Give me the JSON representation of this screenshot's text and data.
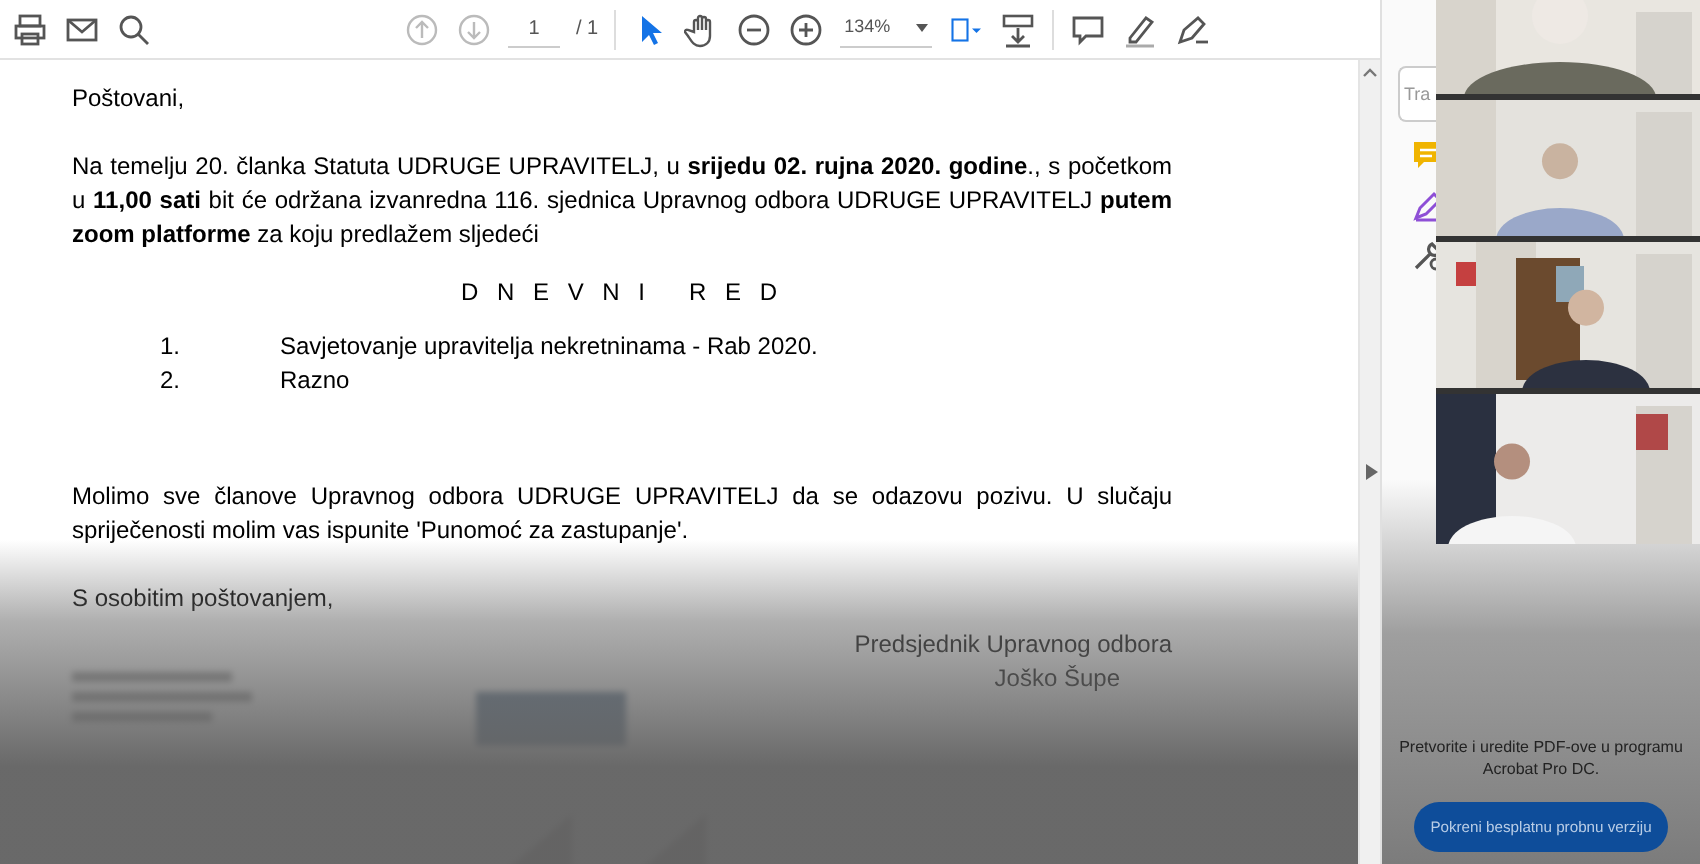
{
  "toolbar": {
    "page_number": "1",
    "page_total": "/ 1",
    "zoom": "134%",
    "tools": [
      {
        "kind": "select",
        "selected": true
      },
      {
        "kind": "hand",
        "selected": false
      }
    ]
  },
  "document": {
    "salutation": "Poštovani,",
    "intro": "Na temelju 20. članka Statuta UDRUGE UPRAVITELJ, u **srijedu 02. rujna 2020. godine**., s početkom u **11,00 sati** bit će održana izvanredna 116. sjednica Upravnog odbora UDRUGE UPRAVITELJ **putem zoom platforme** za koju predlažem sljedeći",
    "agenda_title": "D N E V N I   R E D",
    "agenda": [
      {
        "number": "1.",
        "text": "Savjetovanje upravitelja nekretninama - Rab 2020."
      },
      {
        "number": "2.",
        "text": "Razno"
      }
    ],
    "request": "Molimo sve članove Upravnog odbora UDRUGE UPRAVITELJ da se odazovu pozivu. U slučaju spriječenosti molim vas ispunite 'Punomoć za zastupanje'.",
    "closing": "S osobitim poštovanjem,",
    "signature_title": "Predsjednik Upravnog odbora",
    "signature_name": "Joško Šupe"
  },
  "side_panel": {
    "search": {
      "placeholder": "Tra"
    },
    "promo_text": "Pretvorite i uredite PDF-ove u programu Acrobat Pro DC.",
    "promo_button": "Pokreni besplatnu probnu verziju"
  }
}
